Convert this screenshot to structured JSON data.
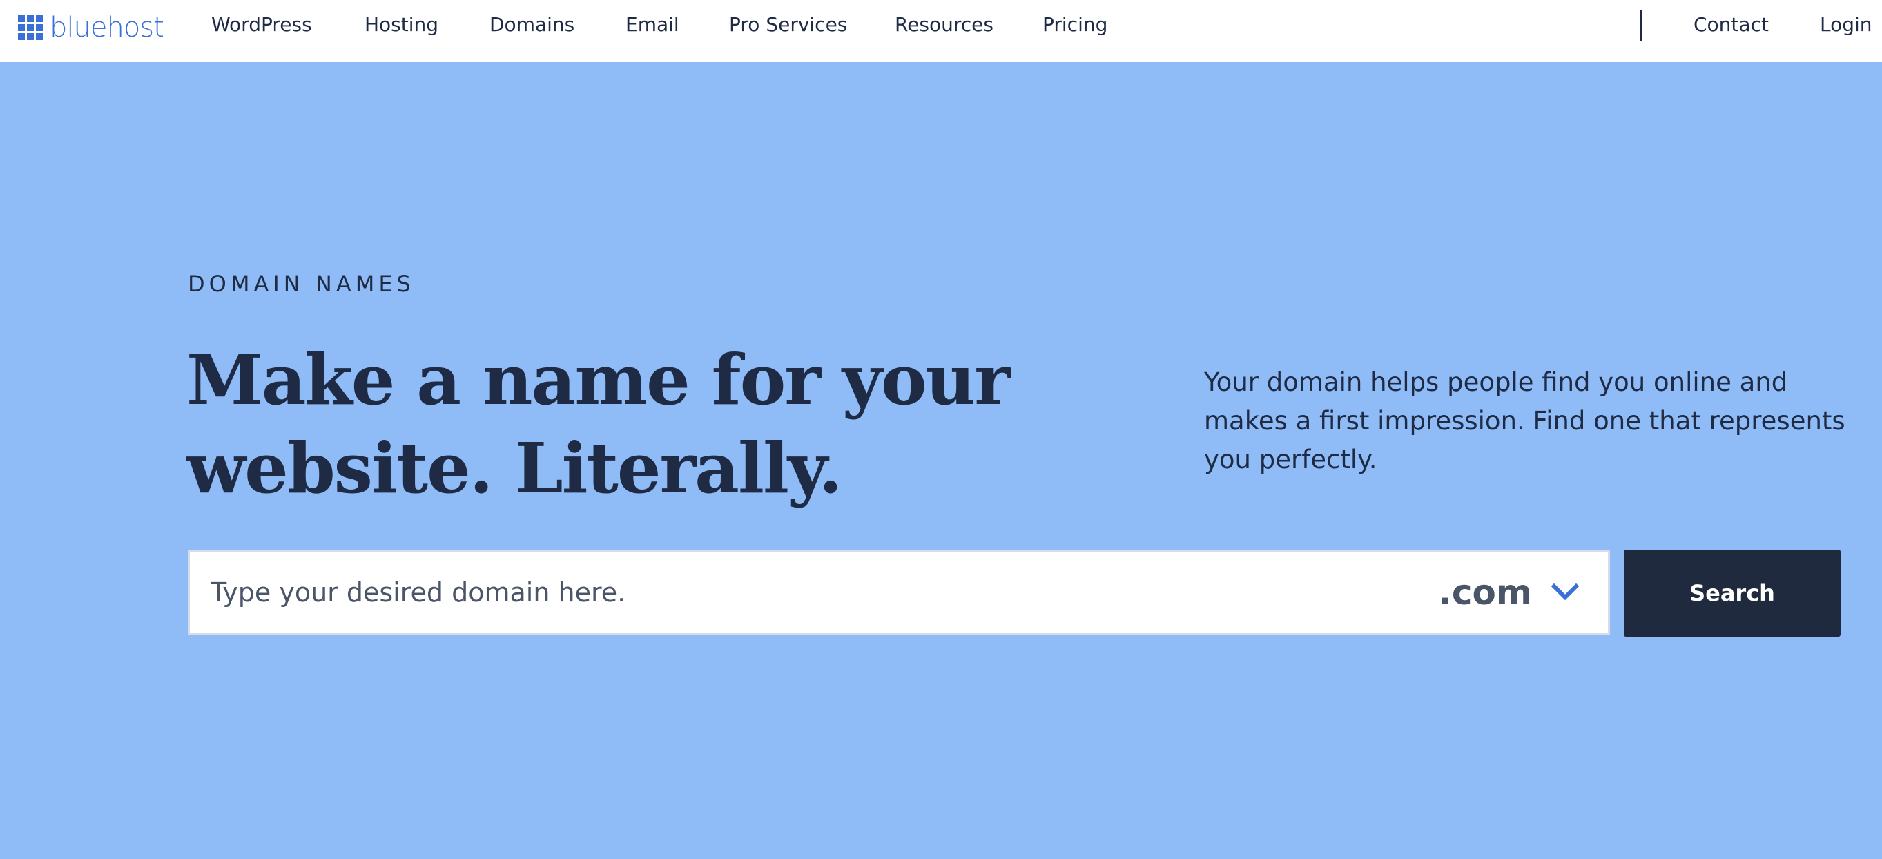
{
  "brand": {
    "logo_text": "bluehost",
    "logo_icon": "grid-icon",
    "color": "#3a6fd8"
  },
  "nav": {
    "items": [
      "WordPress",
      "Hosting",
      "Domains",
      "Email",
      "Pro Services",
      "Resources",
      "Pricing"
    ],
    "right_items": [
      "Contact",
      "Login"
    ]
  },
  "hero": {
    "eyebrow": "DOMAIN NAMES",
    "headline": "Make a name for your website. Literally.",
    "description": "Your domain helps people find you online and makes a first impression. Find one that represents you perfectly.",
    "background_color": "#8fbcf6",
    "text_color": "#1f2a44"
  },
  "search": {
    "placeholder": "Type your desired domain here.",
    "value": "",
    "tld_selected": ".com",
    "tld_icon": "chevron-down-icon",
    "button_label": "Search",
    "button_color": "#1f2a3e"
  }
}
